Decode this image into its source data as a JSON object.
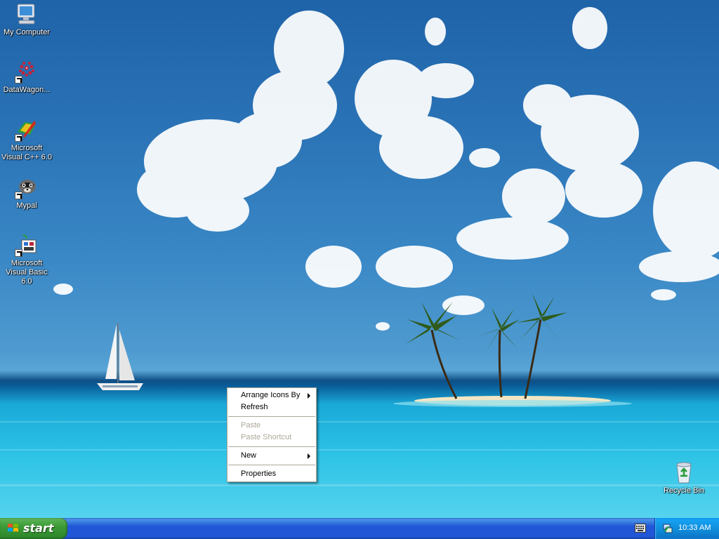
{
  "desktop": {
    "icons": [
      {
        "label": "My Computer",
        "icon": "my-computer-icon"
      },
      {
        "label": "DataWagon...",
        "icon": "datawagon-icon"
      },
      {
        "label": "Microsoft Visual C++ 6.0",
        "icon": "visual-cpp-icon"
      },
      {
        "label": "Mypal",
        "icon": "mypal-icon"
      },
      {
        "label": "Microsoft Visual Basic 6.0",
        "icon": "visual-basic-icon"
      },
      {
        "label": "Recycle Bin",
        "icon": "recycle-bin-icon"
      }
    ]
  },
  "context_menu": {
    "items": [
      {
        "label": "Arrange Icons By",
        "submenu": true,
        "enabled": true
      },
      {
        "label": "Refresh",
        "enabled": true
      },
      {
        "label": "Paste",
        "enabled": false
      },
      {
        "label": "Paste Shortcut",
        "enabled": false
      },
      {
        "label": "New",
        "submenu": true,
        "enabled": true
      },
      {
        "label": "Properties",
        "enabled": true
      }
    ]
  },
  "taskbar": {
    "start_label": "start",
    "clock": "10:33 AM",
    "tray_icons": [
      "keyboard-icon",
      "network-icon"
    ]
  },
  "colors": {
    "taskbar_blue": "#2157d7",
    "start_green": "#3c9b37",
    "tray_blue": "#0f8ad8",
    "menu_disabled": "#aca899"
  }
}
